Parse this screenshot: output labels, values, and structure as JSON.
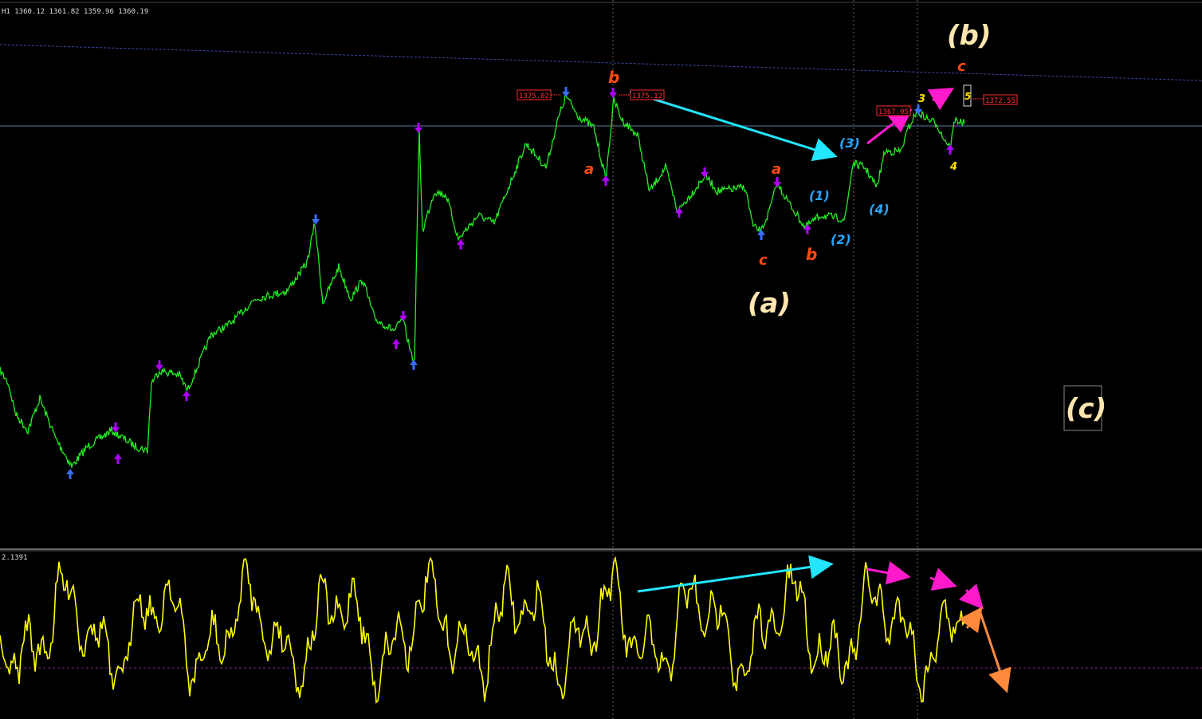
{
  "header": {
    "symbol": "H1",
    "ohlc": "1360.12 1361.82 1359.96 1360.19"
  },
  "indicator": {
    "value_label": "2.1391"
  },
  "price_boxes": [
    {
      "text": "1375.02"
    },
    {
      "text": "1375.12"
    },
    {
      "text": "1367.05"
    },
    {
      "text": "1372.55"
    }
  ],
  "wave_labels": {
    "big_a": "(a)",
    "big_b": "(b)",
    "big_c": "(c)",
    "red_a1": "a",
    "red_b1": "b",
    "red_a2": "a",
    "red_c2": "c",
    "red_b2": "b",
    "red_c3": "c",
    "blue_1": "(1)",
    "blue_2": "(2)",
    "blue_3": "(3)",
    "blue_4": "(4)",
    "yel_3": "3",
    "yel_4": "4",
    "yel_5": "5"
  },
  "colors": {
    "background": "#000000",
    "price_line": "#22ee22",
    "oscillator": "#ffff00",
    "arrow_cyan": "#22e5ff",
    "arrow_magenta": "#ff1acb",
    "arrow_orange": "#ff8a3c",
    "wave_red": "#ff4a10",
    "wave_blue": "#2aa4ff",
    "wave_yellow": "#ffe000",
    "wave_cream": "#ffe6b0",
    "fractal_purple": "#b000ff",
    "fractal_blue": "#3a6dff"
  },
  "chart_data": {
    "type": "line",
    "series": [
      {
        "values": [
          0.0,
          0.0,
          0.0,
          0.0
        ]
      }
    ]
  }
}
